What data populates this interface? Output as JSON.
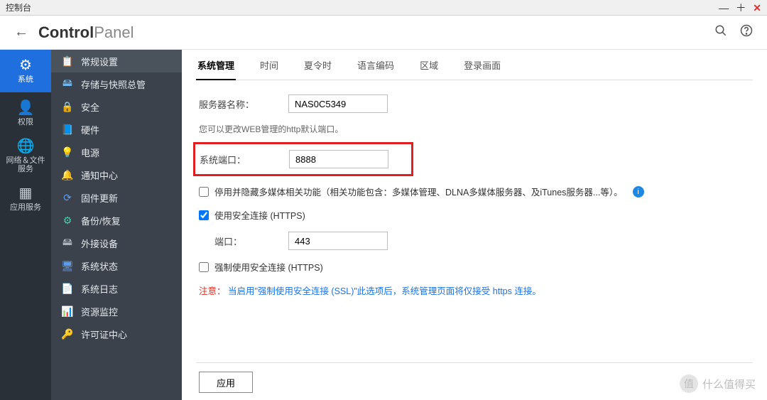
{
  "window": {
    "title": "控制台"
  },
  "header": {
    "brand_bold": "Control",
    "brand_thin": "Panel"
  },
  "nav": [
    {
      "icon": "⚙",
      "label": "系统",
      "active": true
    },
    {
      "icon": "👤",
      "label": "权限",
      "active": false
    },
    {
      "icon": "🌐",
      "label": "网络＆文件\n服务",
      "active": false
    },
    {
      "icon": "▦",
      "label": "应用服务",
      "active": false
    }
  ],
  "sidebar": [
    {
      "icon": "📋",
      "label": "常规设置",
      "selected": true,
      "color": "#ffb84d"
    },
    {
      "icon": "🖴",
      "label": "存储与快照总管",
      "color": "#6bb9f0"
    },
    {
      "icon": "🔒",
      "label": "安全",
      "color": "#aab2bd"
    },
    {
      "icon": "📘",
      "label": "硬件",
      "color": "#48cfad"
    },
    {
      "icon": "💡",
      "label": "电源",
      "color": "#4fc1e9"
    },
    {
      "icon": "🔔",
      "label": "通知中心",
      "color": "#ffce54"
    },
    {
      "icon": "⟳",
      "label": "固件更新",
      "color": "#5d9cec"
    },
    {
      "icon": "⚙",
      "label": "备份/恢复",
      "color": "#48cfad"
    },
    {
      "icon": "🖴",
      "label": "外接设备",
      "color": "#aab2bd"
    },
    {
      "icon": "🖥",
      "label": "系统状态",
      "color": "#5d9cec"
    },
    {
      "icon": "📄",
      "label": "系统日志",
      "color": "#37bc9b"
    },
    {
      "icon": "📊",
      "label": "资源监控",
      "color": "#4fc1e9"
    },
    {
      "icon": "🔑",
      "label": "许可证中心",
      "color": "#48cfad"
    }
  ],
  "tabs": [
    {
      "label": "系统管理",
      "active": true
    },
    {
      "label": "时间",
      "active": false
    },
    {
      "label": "夏令时",
      "active": false
    },
    {
      "label": "语言编码",
      "active": false
    },
    {
      "label": "区域",
      "active": false
    },
    {
      "label": "登录画面",
      "active": false
    }
  ],
  "form": {
    "server_name_label": "服务器名称：",
    "server_name_value": "NAS0C5349",
    "http_hint": "您可以更改WEB管理的http默认端口。",
    "system_port_label": "系统端口：",
    "system_port_value": "8888",
    "checkbox_multimedia": "停用并隐藏多媒体相关功能（相关功能包含：多媒体管理、DLNA多媒体服务器、及iTunes服务器...等）。",
    "checkbox_https": "使用安全连接 (HTTPS)",
    "port_label": "端口：",
    "port_value": "443",
    "checkbox_force_https": "强制使用安全连接 (HTTPS)",
    "notice_red": "注意：",
    "notice_blue": "当启用\"强制使用安全连接 (SSL)\"此选项后，系统管理页面将仅接受 https 连接。",
    "apply_button": "应用"
  },
  "watermark": "什么值得买"
}
